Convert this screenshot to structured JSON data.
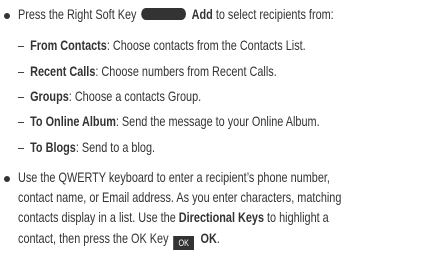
{
  "bullet1": {
    "text_before": "Press the Right Soft Key",
    "softkey_icon": "right-soft-key-icon",
    "key_label": "Add",
    "text_after": " to select recipients from:"
  },
  "subitems": [
    {
      "dash": "–",
      "label": "From Contacts",
      "desc": ": Choose contacts from the Contacts List."
    },
    {
      "dash": "–",
      "label": "Recent Calls",
      "desc": ": Choose numbers from Recent Calls."
    },
    {
      "dash": "–",
      "label": "Groups",
      "desc": ": Choose a contacts Group."
    },
    {
      "dash": "–",
      "label": "To Online Album",
      "desc": ": Send the message to your Online Album."
    },
    {
      "dash": "–",
      "label": "To Blogs",
      "desc": ": Send to a blog."
    }
  ],
  "bullet2": {
    "line1": "Use the QWERTY keyboard to enter a recipient’s phone number,",
    "line2": "contact name, or Email address. As you enter characters, matching",
    "line3_before": "contacts display in a list. Use the ",
    "line3_bold": "Directional Keys",
    "line3_after": " to highlight a",
    "line4_before": "contact, then press the OK Key",
    "ok_icon_text": "OK",
    "line4_bold": "OK",
    "line4_end": "."
  }
}
